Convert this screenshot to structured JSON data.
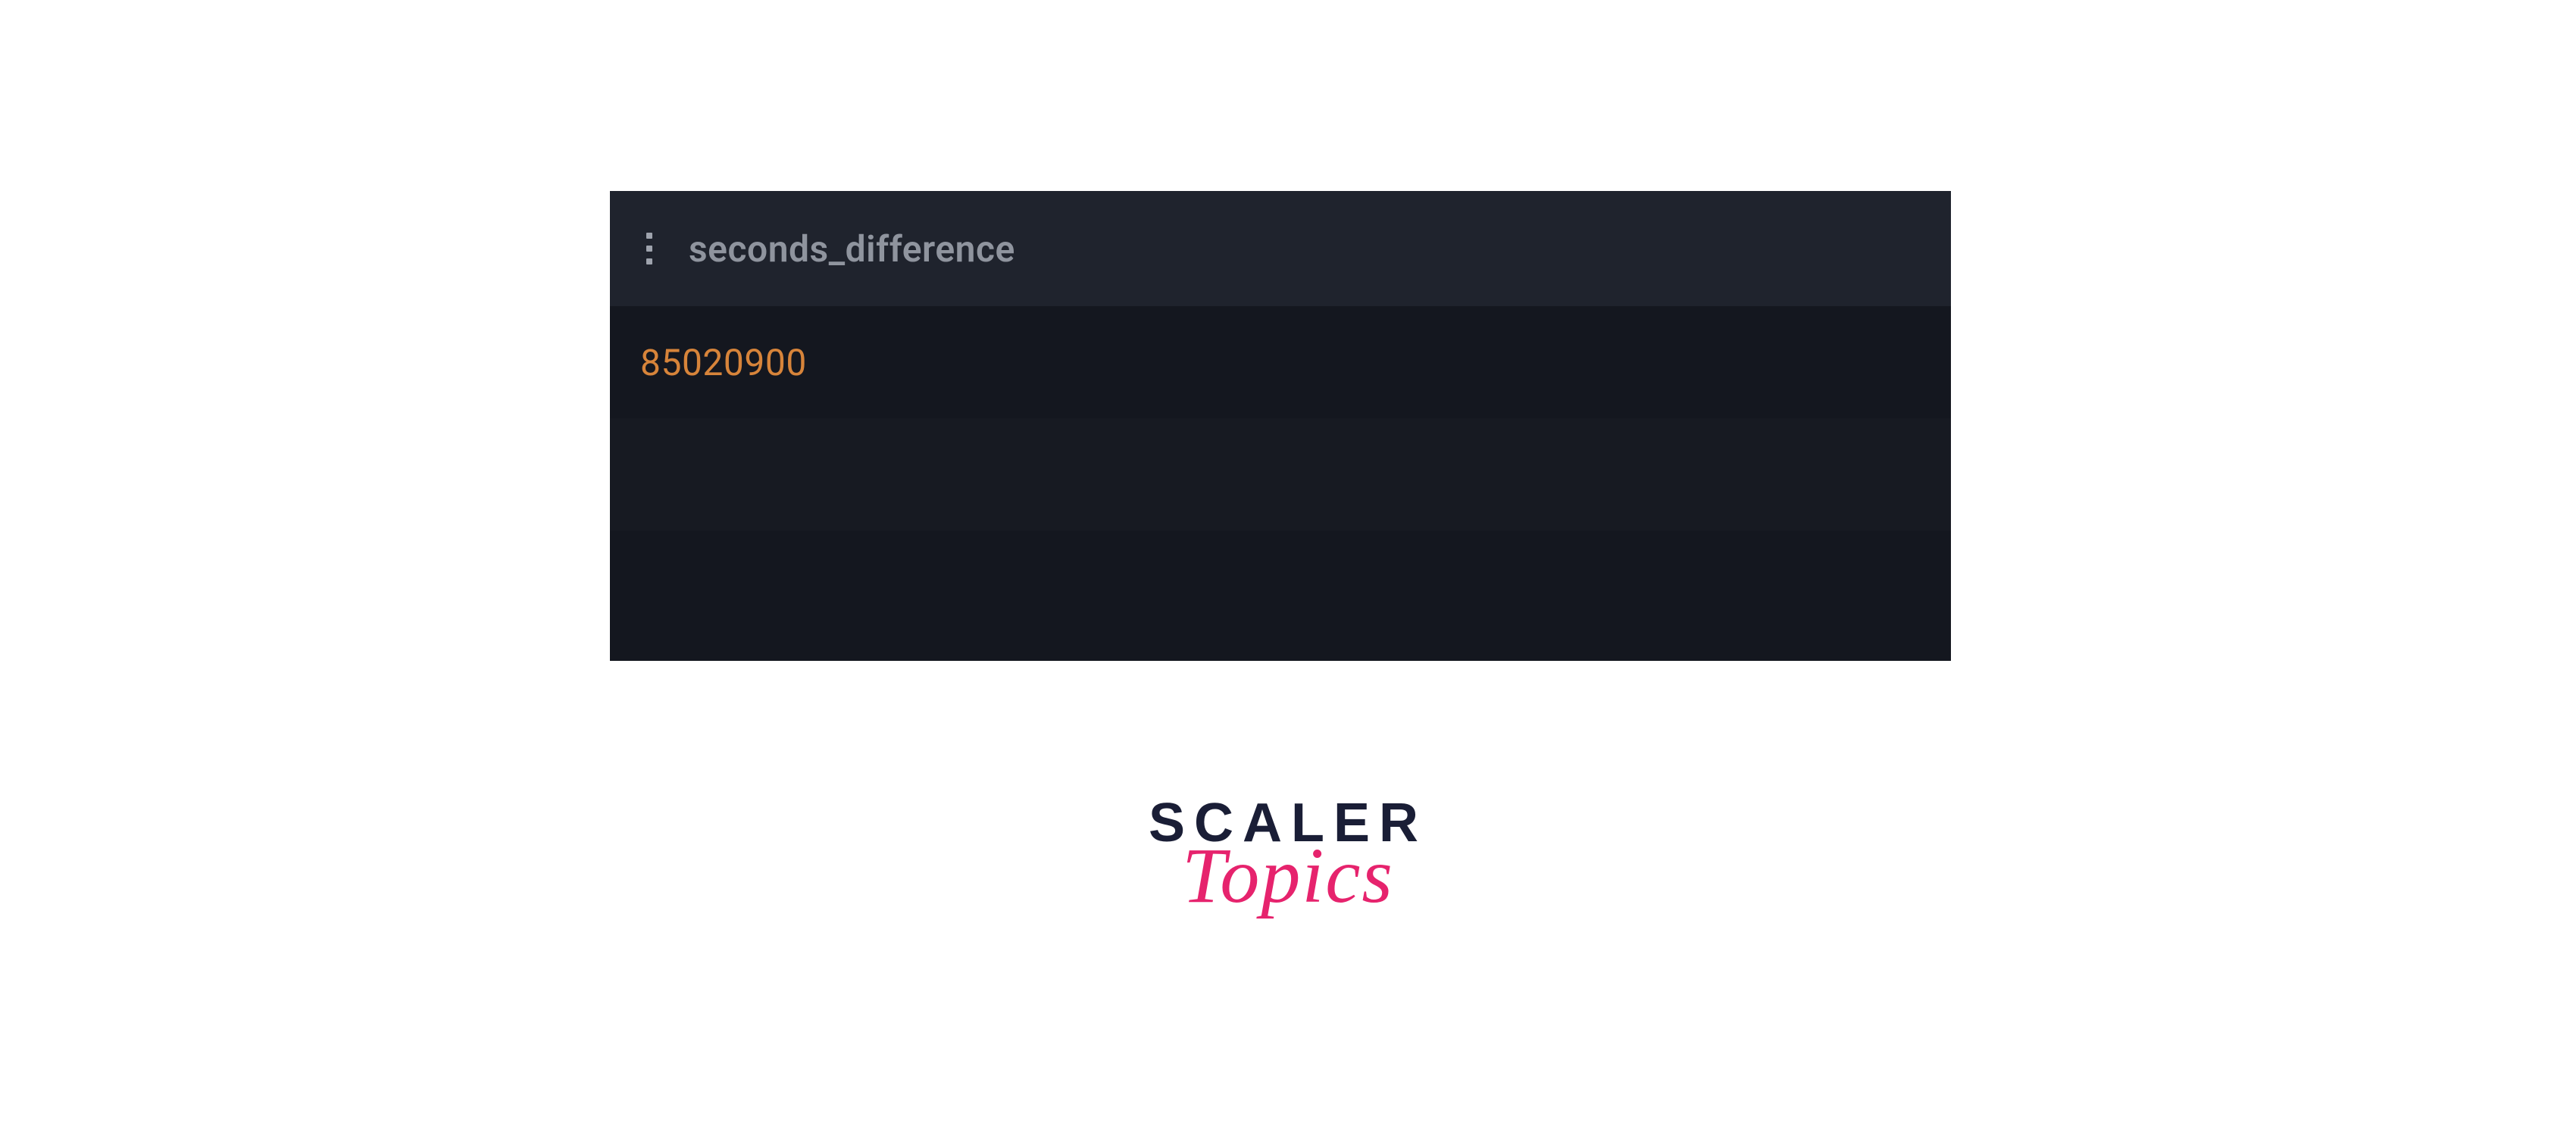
{
  "result": {
    "column_name": "seconds_difference",
    "value": "85020900"
  },
  "brand": {
    "line1": "SCALER",
    "line2": "Topics"
  }
}
